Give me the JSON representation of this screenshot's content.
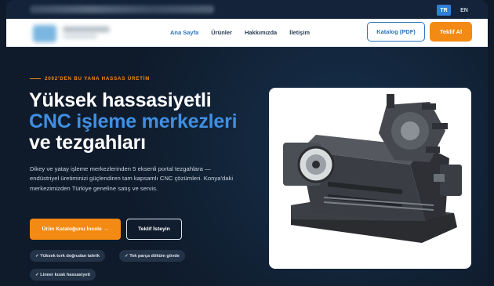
{
  "topbar": {
    "lang_tr": "TR",
    "lang_en": "EN"
  },
  "nav": {
    "links": [
      "Ana Sayfa",
      "Ürünler",
      "Hakkımızda",
      "İletişim"
    ],
    "catalog_button": "Katalog (PDF)",
    "quote_button": "Teklif Al"
  },
  "hero": {
    "eyebrow": "2002'DEN BU YANA HASSAS ÜRETİM",
    "headline_line1": "Yüksek hassasiyetli",
    "headline_line2": "CNC işleme merkezleri",
    "headline_line3": "ve tezgahları",
    "lede": "Dikey ve yatay işleme merkezlerinden 5 eksenli portal tezgahlara — endüstriyel üretiminizi güçlendiren tam kapsamlı CNC çözümleri. Konya'daki merkezimizden Türkiye geneline satış ve servis.",
    "cta_primary": "Ürün Kataloğunu İncele →",
    "cta_secondary": "Teklif İsteyin",
    "chips": [
      "✓ Yüksek tork doğrudan tahrik",
      "✓ Tek parça döküm gövde",
      "✓ Lineer kızak hassasiyeti"
    ]
  },
  "colors": {
    "accent_orange": "#f28a13",
    "accent_blue": "#3f8fe3",
    "background": "#0f1b2b"
  }
}
